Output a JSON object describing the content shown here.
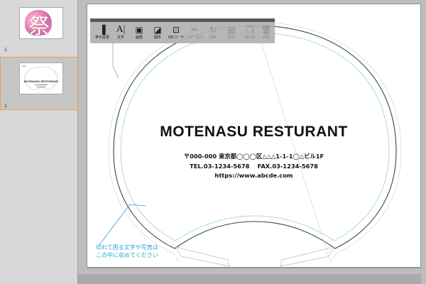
{
  "pages": [
    {
      "number": "1",
      "glyph": "祭"
    },
    {
      "number": "1",
      "title": "MOTENASU RESTURANT"
    }
  ],
  "toolbar": {
    "items": [
      {
        "id": "display",
        "label": "表示変更",
        "icon": "display-toggle-icon"
      },
      {
        "id": "text",
        "label": "文字",
        "icon": "text-icon"
      },
      {
        "id": "image",
        "label": "画像",
        "icon": "image-icon"
      },
      {
        "id": "shape",
        "label": "図形",
        "icon": "shape-icon"
      },
      {
        "id": "qr",
        "label": "QRコード",
        "icon": "qr-code-icon"
      },
      {
        "id": "copypaste",
        "label": "コピー貼付",
        "icon": "copy-paste-icon",
        "disabled": true
      },
      {
        "id": "rotate",
        "label": "回転",
        "icon": "rotate-icon",
        "disabled": true
      },
      {
        "id": "align",
        "label": "整列",
        "icon": "align-icon",
        "disabled": true
      },
      {
        "id": "order",
        "label": "重ね順",
        "icon": "layer-order-icon",
        "disabled": true
      },
      {
        "id": "delete",
        "label": "削除",
        "icon": "delete-icon",
        "disabled": true
      }
    ]
  },
  "fan": {
    "title": "MOTENASU RESTURANT",
    "address": "〒000-000 東京都◯◯◯区△△△1-1-1◯△ビル1F",
    "phone_fax": "TEL.03-1234-5678　 FAX.03-1234-5678",
    "url": "https://www.abcde.com"
  },
  "guide_note": {
    "line1": "切れて困る文字や写真は",
    "line2": "この中に収めてください"
  },
  "colors": {
    "guide": "#29a3d8",
    "selection": "#e6a24c"
  }
}
